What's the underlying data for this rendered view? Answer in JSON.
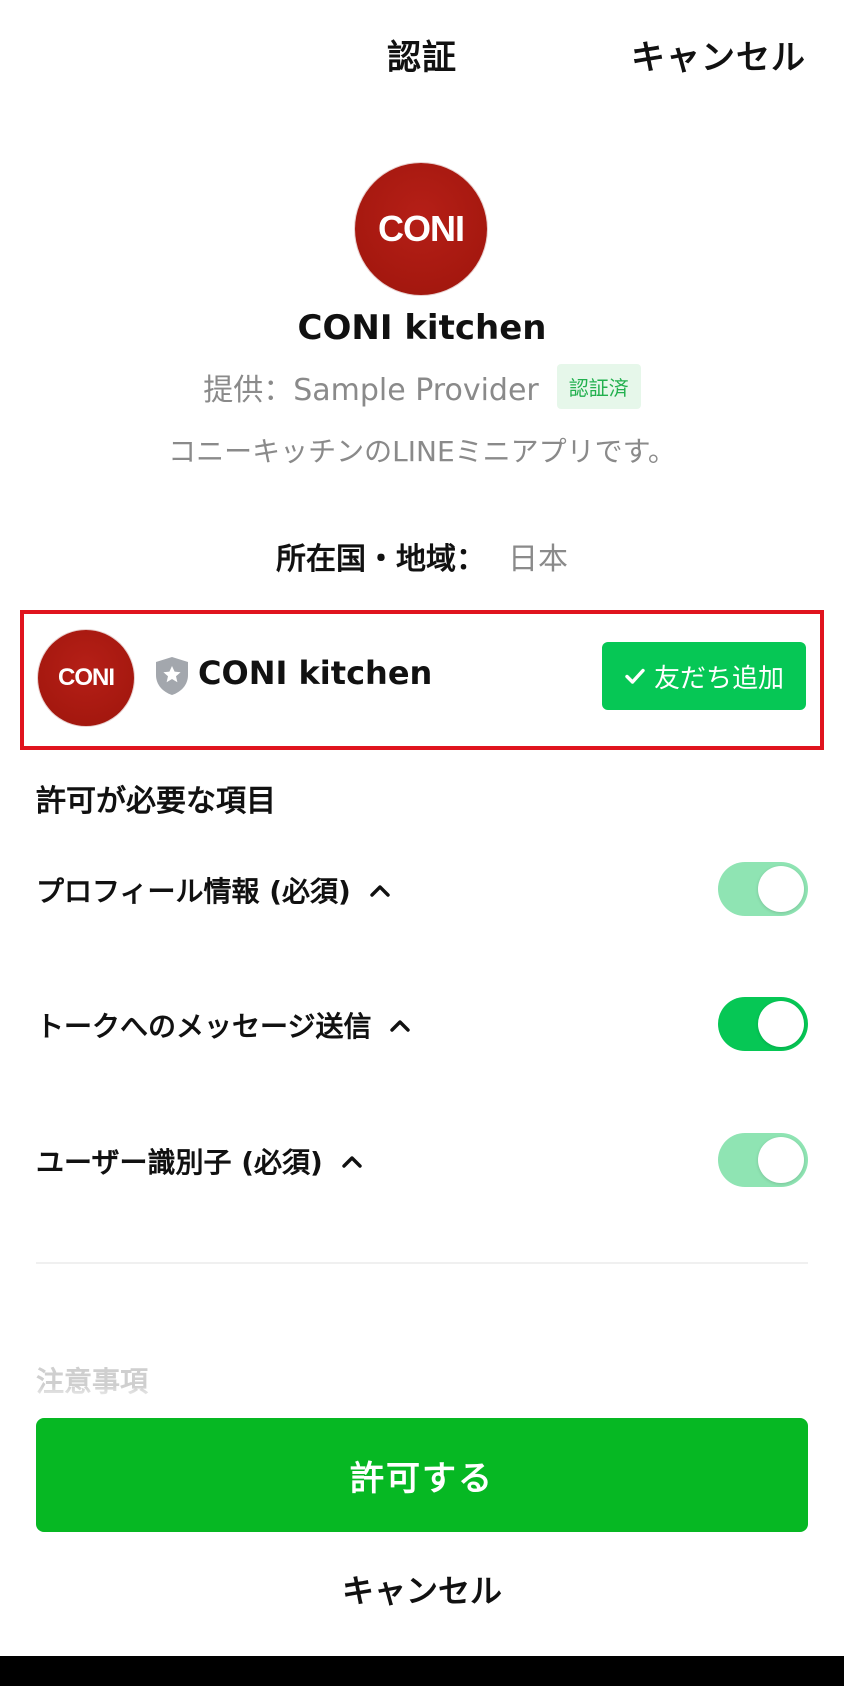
{
  "header": {
    "title": "認証",
    "cancel_label": "キャンセル"
  },
  "app": {
    "logo_text": "CONI",
    "name": "CONI kitchen",
    "provider": "提供：Sample Provider",
    "verified_badge": "認証済",
    "description": "コニーキッチンのLINEミニアプリです。",
    "region_label": "所在国・地域：",
    "region_value": "日本"
  },
  "official_account": {
    "logo_text": "CONI",
    "name": "CONI kitchen",
    "add_friend_label": "友だち追加",
    "shield_icon": "shield-star-icon"
  },
  "permissions": {
    "heading": "許可が必要な項目",
    "items": [
      {
        "label": "プロフィール情報 (必須)",
        "state": "on-required"
      },
      {
        "label": "トークへのメッセージ送信",
        "state": "on"
      },
      {
        "label": "ユーザー識別子 (必須)",
        "state": "on-required"
      }
    ]
  },
  "notes": {
    "title": "注意事項"
  },
  "actions": {
    "allow_label": "許可する",
    "cancel_label": "キャンセル"
  },
  "colors": {
    "line_green": "#06c755",
    "allow_green": "#06b823",
    "toggle_disabled": "#8fe4b3",
    "highlight_red": "#e0141e",
    "logo_red": "#a5180f"
  }
}
